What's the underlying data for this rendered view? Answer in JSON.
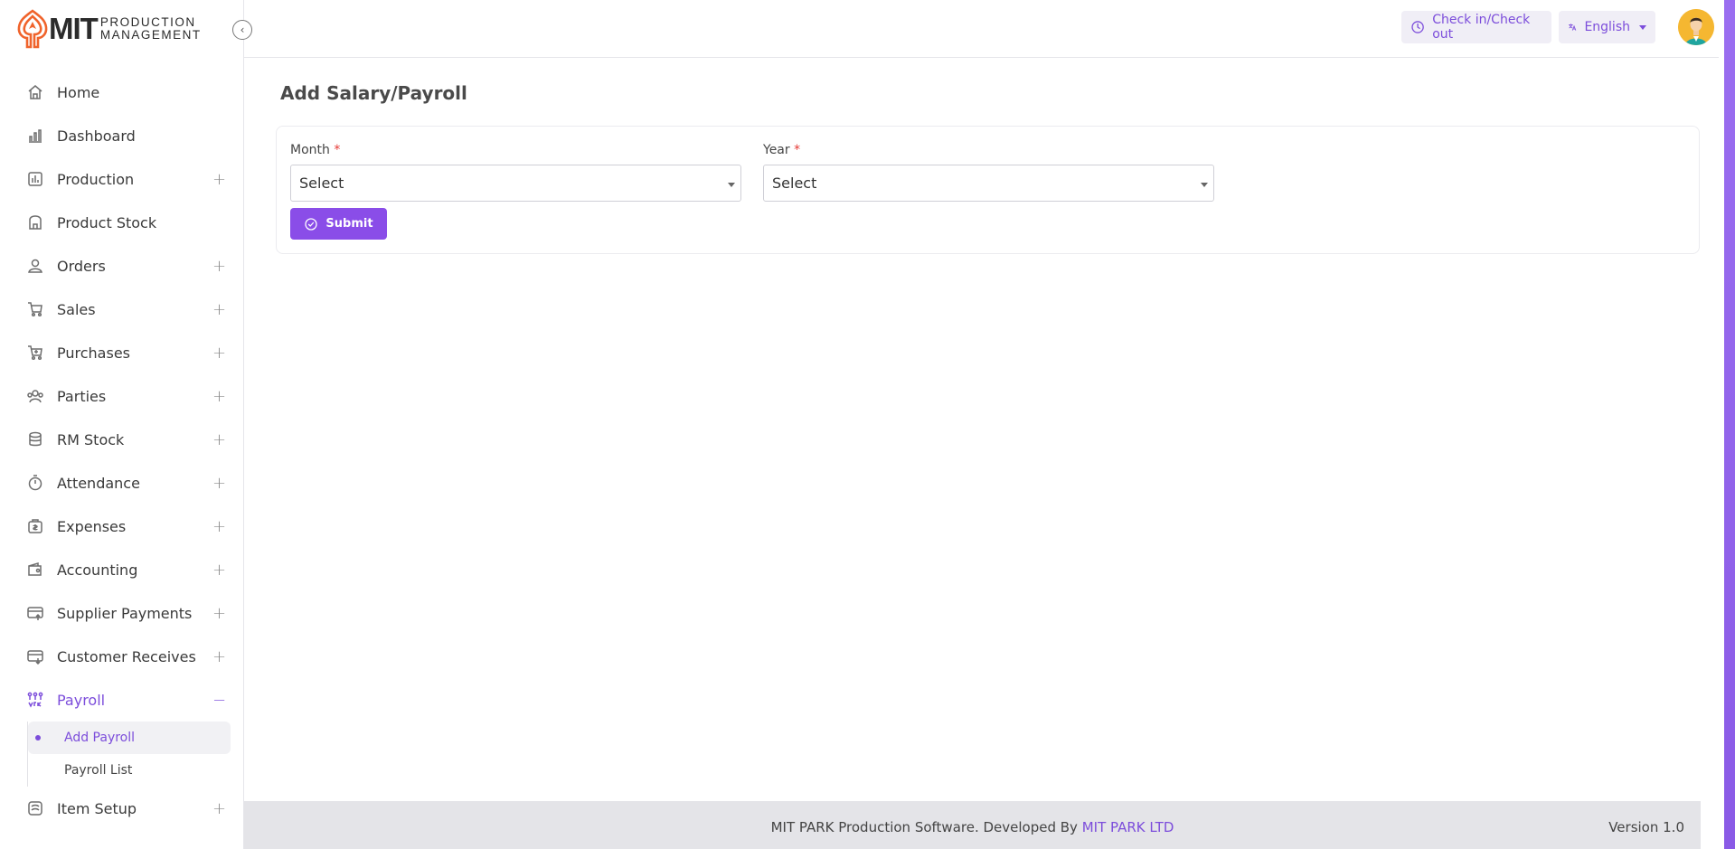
{
  "brand": {
    "name": "MIT",
    "sub_line1": "PRODUCTION",
    "sub_line2": "MANAGEMENT"
  },
  "header": {
    "checkin_label": "Check in/Check out",
    "language_label": "English"
  },
  "sidebar": {
    "items": [
      {
        "label": "Home",
        "icon": "home-icon",
        "expandable": false
      },
      {
        "label": "Dashboard",
        "icon": "dashboard-icon",
        "expandable": false
      },
      {
        "label": "Production",
        "icon": "production-icon",
        "expandable": true
      },
      {
        "label": "Product Stock",
        "icon": "product-stock-icon",
        "expandable": false
      },
      {
        "label": "Orders",
        "icon": "orders-icon",
        "expandable": true
      },
      {
        "label": "Sales",
        "icon": "cart-icon",
        "expandable": true
      },
      {
        "label": "Purchases",
        "icon": "purchase-cart-icon",
        "expandable": true
      },
      {
        "label": "Parties",
        "icon": "parties-icon",
        "expandable": true
      },
      {
        "label": "RM Stock",
        "icon": "database-icon",
        "expandable": true
      },
      {
        "label": "Attendance",
        "icon": "stopwatch-icon",
        "expandable": true
      },
      {
        "label": "Expenses",
        "icon": "expenses-icon",
        "expandable": true
      },
      {
        "label": "Accounting",
        "icon": "wallet-icon",
        "expandable": true
      },
      {
        "label": "Supplier Payments",
        "icon": "supplier-payment-icon",
        "expandable": true
      },
      {
        "label": "Customer Receives",
        "icon": "customer-receive-icon",
        "expandable": true
      },
      {
        "label": "Payroll",
        "icon": "payroll-icon",
        "expandable": true,
        "active": true
      },
      {
        "label": "Item Setup",
        "icon": "item-setup-icon",
        "expandable": true
      }
    ],
    "payroll_sub": [
      {
        "label": "Add Payroll",
        "active": true
      },
      {
        "label": "Payroll List",
        "active": false
      }
    ]
  },
  "main": {
    "title": "Add Salary/Payroll",
    "month_label": "Month",
    "year_label": "Year",
    "required_mark": "*",
    "month_value": "Select",
    "year_value": "Select",
    "submit_label": "Submit"
  },
  "footer": {
    "credit_text": "MIT PARK Production Software. Developed By ",
    "credit_link": "MIT PARK LTD",
    "version": "Version 1.0"
  },
  "colors": {
    "accent": "#7c4ddb",
    "button": "#8a4de8",
    "footer_bg": "#e4e4e8"
  }
}
